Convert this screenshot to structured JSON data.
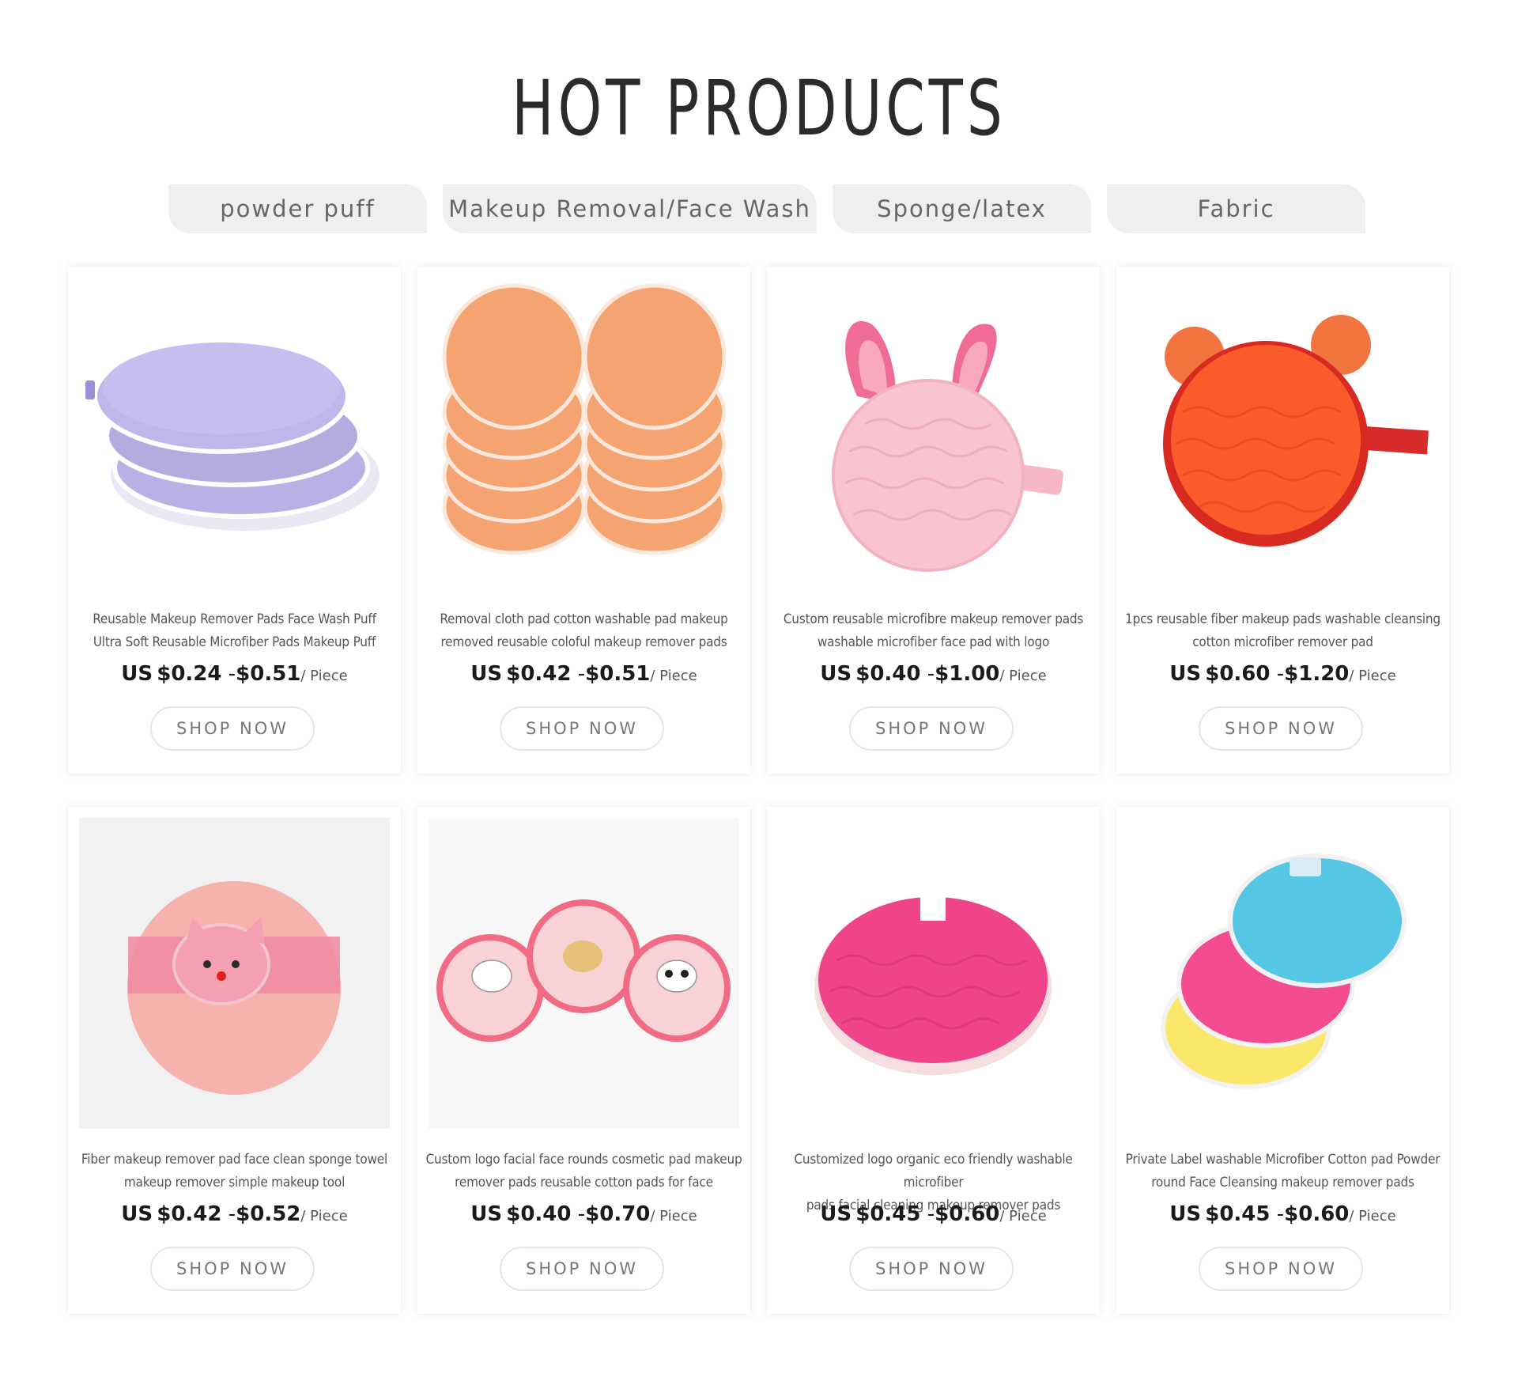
{
  "section": {
    "title": "HOT PRODUCTS"
  },
  "tabs": [
    {
      "label": "powder puff"
    },
    {
      "label": "Makeup Removal/Face Wash"
    },
    {
      "label": "Sponge/latex"
    },
    {
      "label": "Fabric"
    }
  ],
  "products": [
    {
      "name_line1": "Reusable Makeup Remover Pads Face Wash Puff",
      "name_line2": "Ultra Soft Reusable Microfiber Pads Makeup Puff",
      "currency": "US",
      "price_low": "$0.24",
      "price_high": "$0.51",
      "unit": "/ Piece",
      "button": "SHOP NOW",
      "image_icon": "lavender-pads-image"
    },
    {
      "name_line1": "Removal cloth pad cotton washable pad makeup",
      "name_line2": "removed reusable coloful makeup remover pads",
      "currency": "US",
      "price_low": "$0.42",
      "price_high": "$0.51",
      "unit": "/ Piece",
      "button": "SHOP NOW",
      "image_icon": "orange-pads-stack-image"
    },
    {
      "name_line1": "Custom reusable microfibre makeup remover pads",
      "name_line2": "washable microfiber face pad with logo",
      "currency": "US",
      "price_low": "$0.40",
      "price_high": "$1.00",
      "unit": "/ Piece",
      "button": "SHOP NOW",
      "image_icon": "pink-bunny-pad-image"
    },
    {
      "name_line1": "1pcs reusable fiber makeup pads washable cleansing",
      "name_line2": "cotton microfiber remover pad",
      "currency": "US",
      "price_low": "$0.60",
      "price_high": "$1.20",
      "unit": "/ Piece",
      "button": "SHOP NOW",
      "image_icon": "orange-bear-pad-image"
    },
    {
      "name_line1": "Fiber makeup remover pad face clean sponge towel",
      "name_line2": "makeup remover simple makeup tool",
      "currency": "US",
      "price_low": "$0.42",
      "price_high": "$0.52",
      "unit": "/ Piece",
      "button": "SHOP NOW",
      "image_icon": "pink-cat-puff-image"
    },
    {
      "name_line1": "Custom logo facial face rounds cosmetic pad makeup",
      "name_line2": "remover pads reusable cotton pads for face",
      "currency": "US",
      "price_low": "$0.40",
      "price_high": "$0.70",
      "unit": "/ Piece",
      "button": "SHOP NOW",
      "image_icon": "animal-puffs-image"
    },
    {
      "name_line1": "Customized logo organic eco friendly washable microfiber",
      "name_line2": "pads facial cleaning makeup remover pads",
      "currency": "US",
      "price_low": "$0.45",
      "price_high": "$0.60",
      "unit": "/ Piece",
      "button": "SHOP NOW",
      "image_icon": "magenta-pad-image"
    },
    {
      "name_line1": "Private Label washable Microfiber Cotton pad Powder",
      "name_line2": "round Face Cleansing makeup remover pads",
      "currency": "US",
      "price_low": "$0.45",
      "price_high": "$0.60",
      "unit": "/ Piece",
      "button": "SHOP NOW",
      "image_icon": "colorful-pads-image"
    }
  ],
  "colors": {
    "tab_bg": "#efefef",
    "title": "#2b2b2b",
    "button_border": "#e6e6e6"
  }
}
